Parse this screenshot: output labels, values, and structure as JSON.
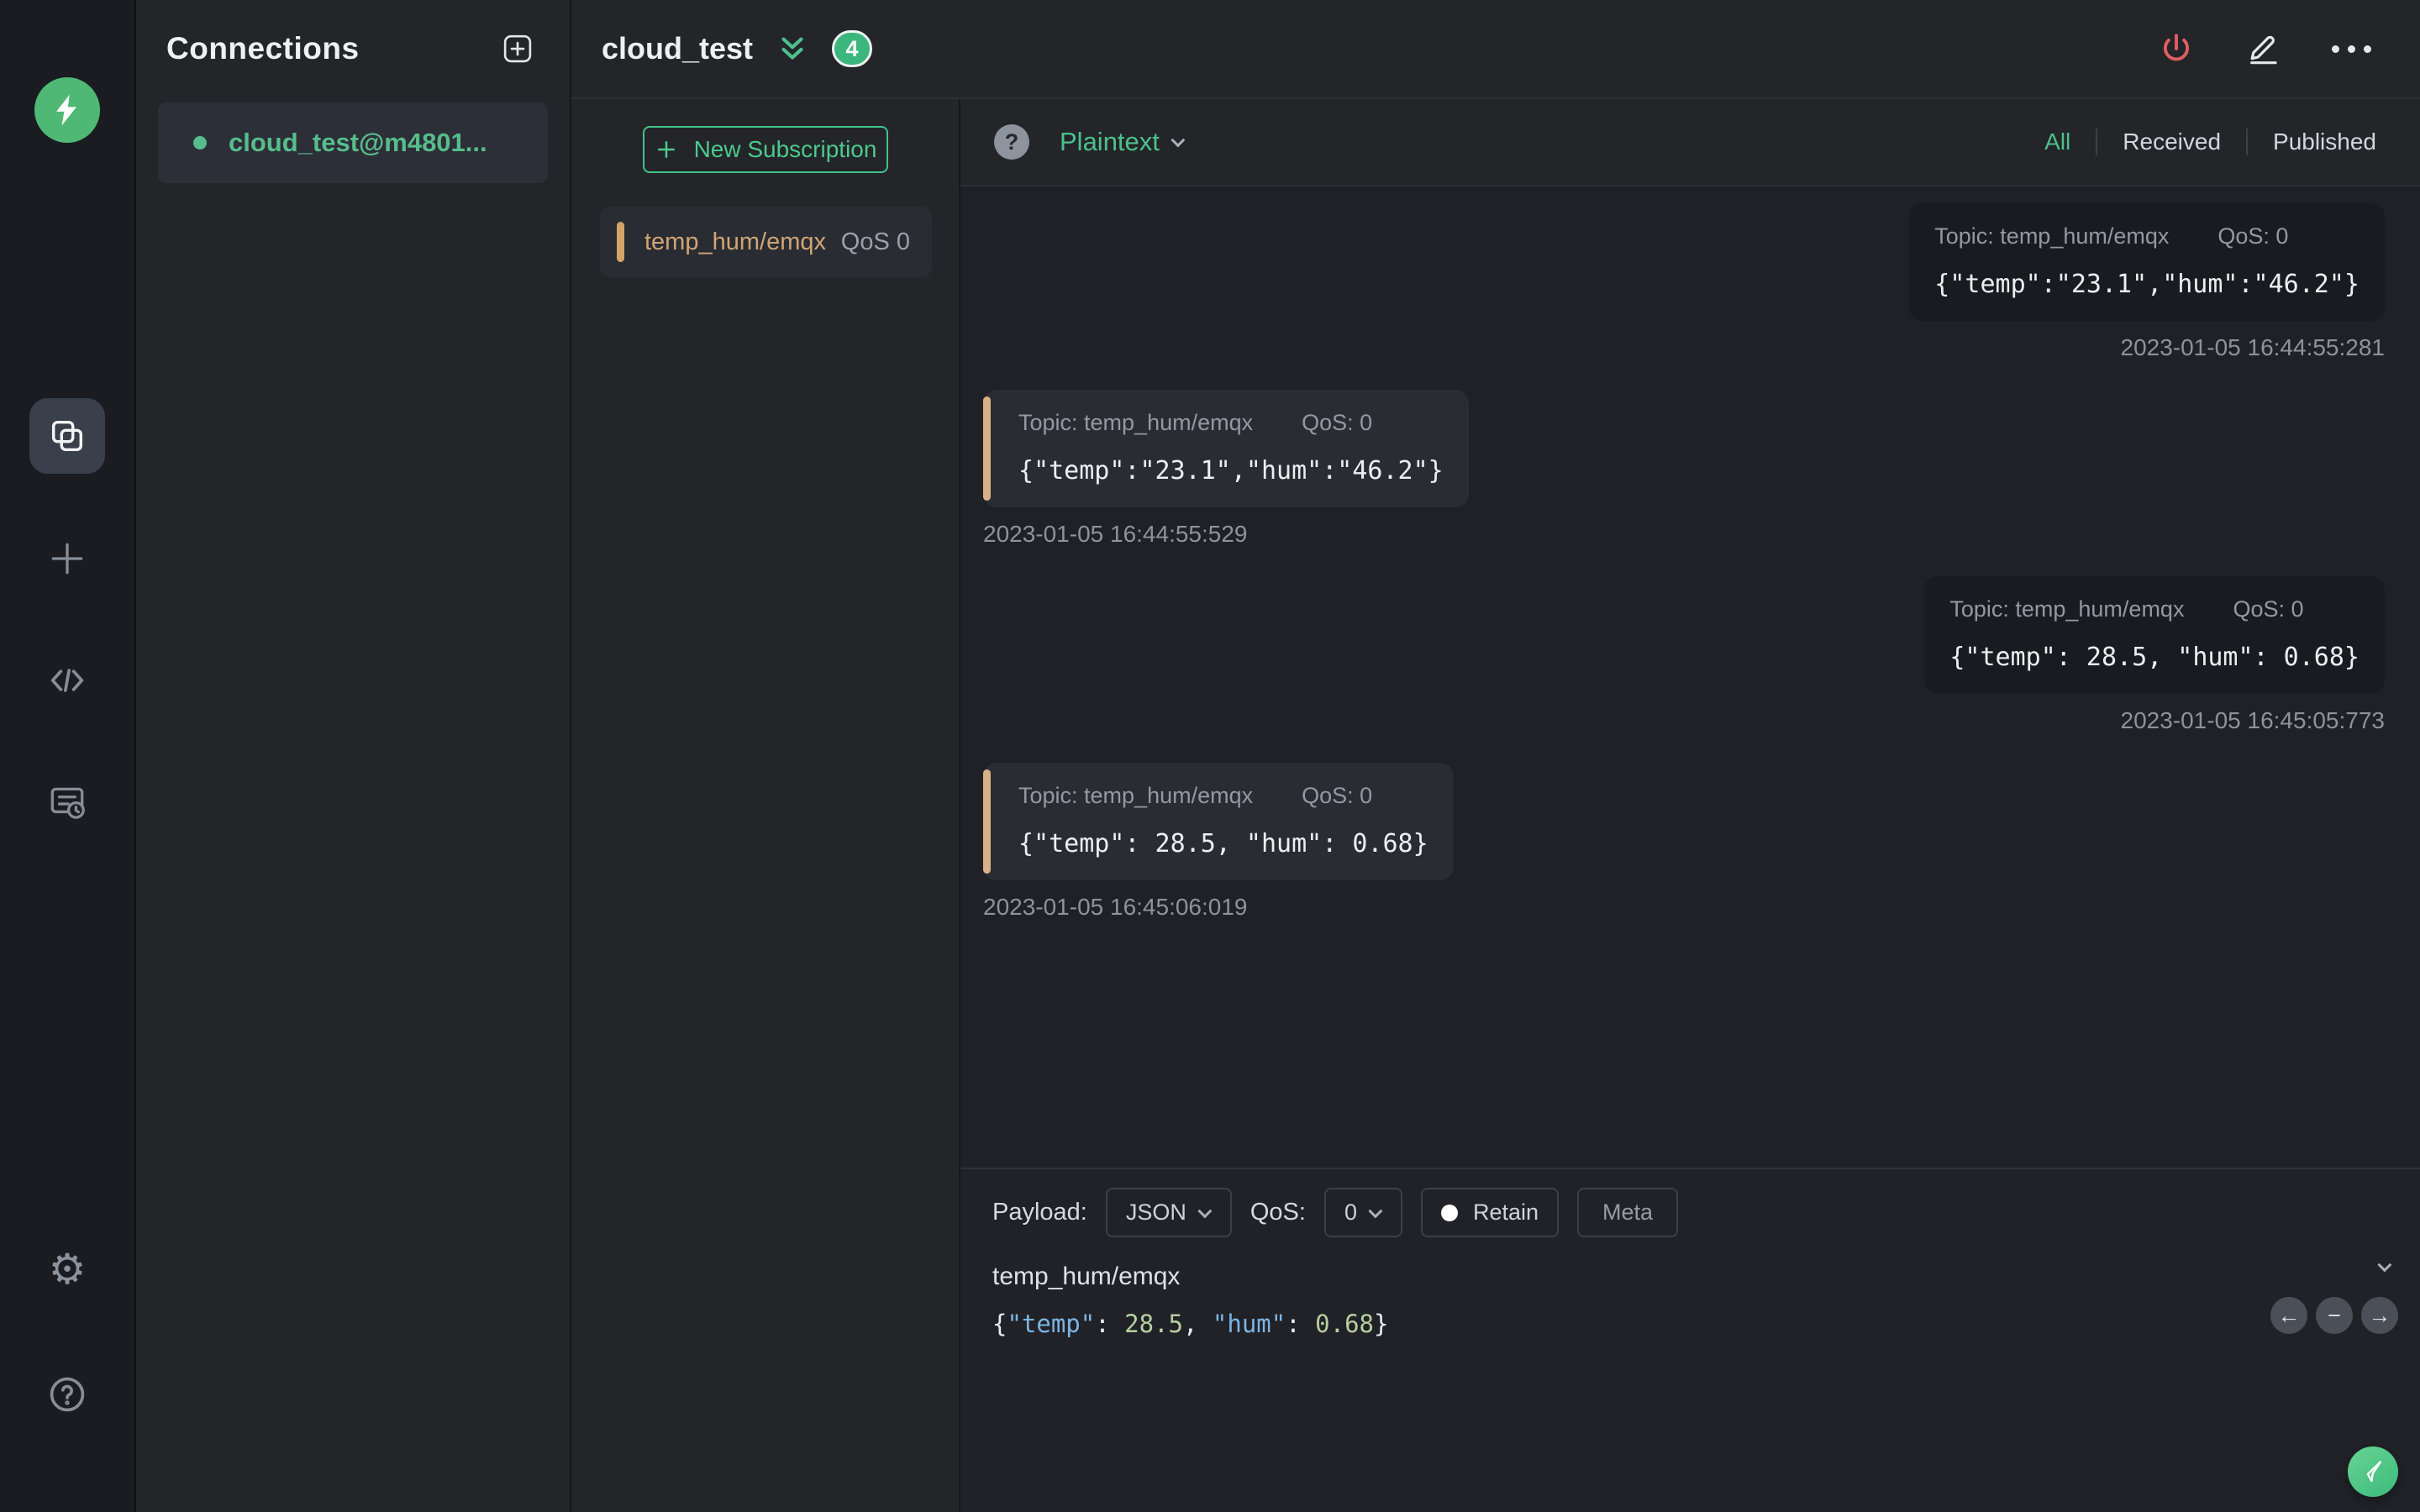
{
  "colors": {
    "accent_green": "#4cc08c",
    "badge_green": "#3bb77d",
    "logo_green": "#4fb874",
    "subscription_orange": "#d3a574",
    "message_bar_orange": "#d9b186",
    "power_red": "#e06060",
    "json_key_blue": "#7cb5e3",
    "json_number_green": "#b6cfa0"
  },
  "rail": {
    "icons": [
      "mqttx-logo",
      "connections-icon",
      "plus-icon",
      "code-icon",
      "log-icon",
      "settings-gear-icon",
      "help-icon"
    ],
    "active_item": "connections",
    "settings_glyph": "⚙",
    "help_glyph": "?"
  },
  "connections_panel": {
    "title": "Connections",
    "items": [
      {
        "name": "cloud_test@m4801...",
        "status": "connected"
      }
    ]
  },
  "header": {
    "title": "cloud_test",
    "message_count_badge": "4",
    "actions": [
      "disconnect-power-icon",
      "edit-pencil-icon",
      "more-options-icon"
    ]
  },
  "subscriptions": {
    "new_subscription_label": "New Subscription",
    "items": [
      {
        "topic": "temp_hum/emqx",
        "qos": "QoS 0"
      }
    ]
  },
  "message_pane": {
    "format_selector": {
      "value": "Plaintext",
      "help_glyph": "?"
    },
    "filters": {
      "all": "All",
      "received": "Received",
      "published": "Published",
      "active": "All"
    },
    "messages": [
      {
        "direction": "published",
        "topic": "Topic: temp_hum/emqx",
        "qos": "QoS: 0",
        "payload": "{\"temp\":\"23.1\",\"hum\":\"46.2\"}",
        "timestamp": "2023-01-05 16:44:55:281"
      },
      {
        "direction": "received",
        "topic": "Topic: temp_hum/emqx",
        "qos": "QoS: 0",
        "payload": "{\"temp\":\"23.1\",\"hum\":\"46.2\"}",
        "timestamp": "2023-01-05 16:44:55:529"
      },
      {
        "direction": "published",
        "topic": "Topic: temp_hum/emqx",
        "qos": "QoS: 0",
        "payload": "{\"temp\": 28.5, \"hum\": 0.68}",
        "timestamp": "2023-01-05 16:45:05:773"
      },
      {
        "direction": "received",
        "topic": "Topic: temp_hum/emqx",
        "qos": "QoS: 0",
        "payload": "{\"temp\": 28.5, \"hum\": 0.68}",
        "timestamp": "2023-01-05 16:45:06:019"
      }
    ]
  },
  "publish": {
    "payload_label": "Payload:",
    "payload_format": "JSON",
    "qos_label": "QoS:",
    "qos_value": "0",
    "retain_label": "Retain",
    "meta_label": "Meta",
    "topic_value": "temp_hum/emqx",
    "editor_tokens": [
      {
        "type": "punct",
        "v": "{"
      },
      {
        "type": "key",
        "v": "\"temp\""
      },
      {
        "type": "punct",
        "v": ": "
      },
      {
        "type": "number",
        "v": "28.5"
      },
      {
        "type": "punct",
        "v": ", "
      },
      {
        "type": "key",
        "v": "\"hum\""
      },
      {
        "type": "punct",
        "v": ": "
      },
      {
        "type": "number",
        "v": "0.68"
      },
      {
        "type": "punct",
        "v": "}"
      }
    ],
    "history_nav": {
      "prev": "←",
      "remove": "−",
      "next": "→"
    }
  }
}
